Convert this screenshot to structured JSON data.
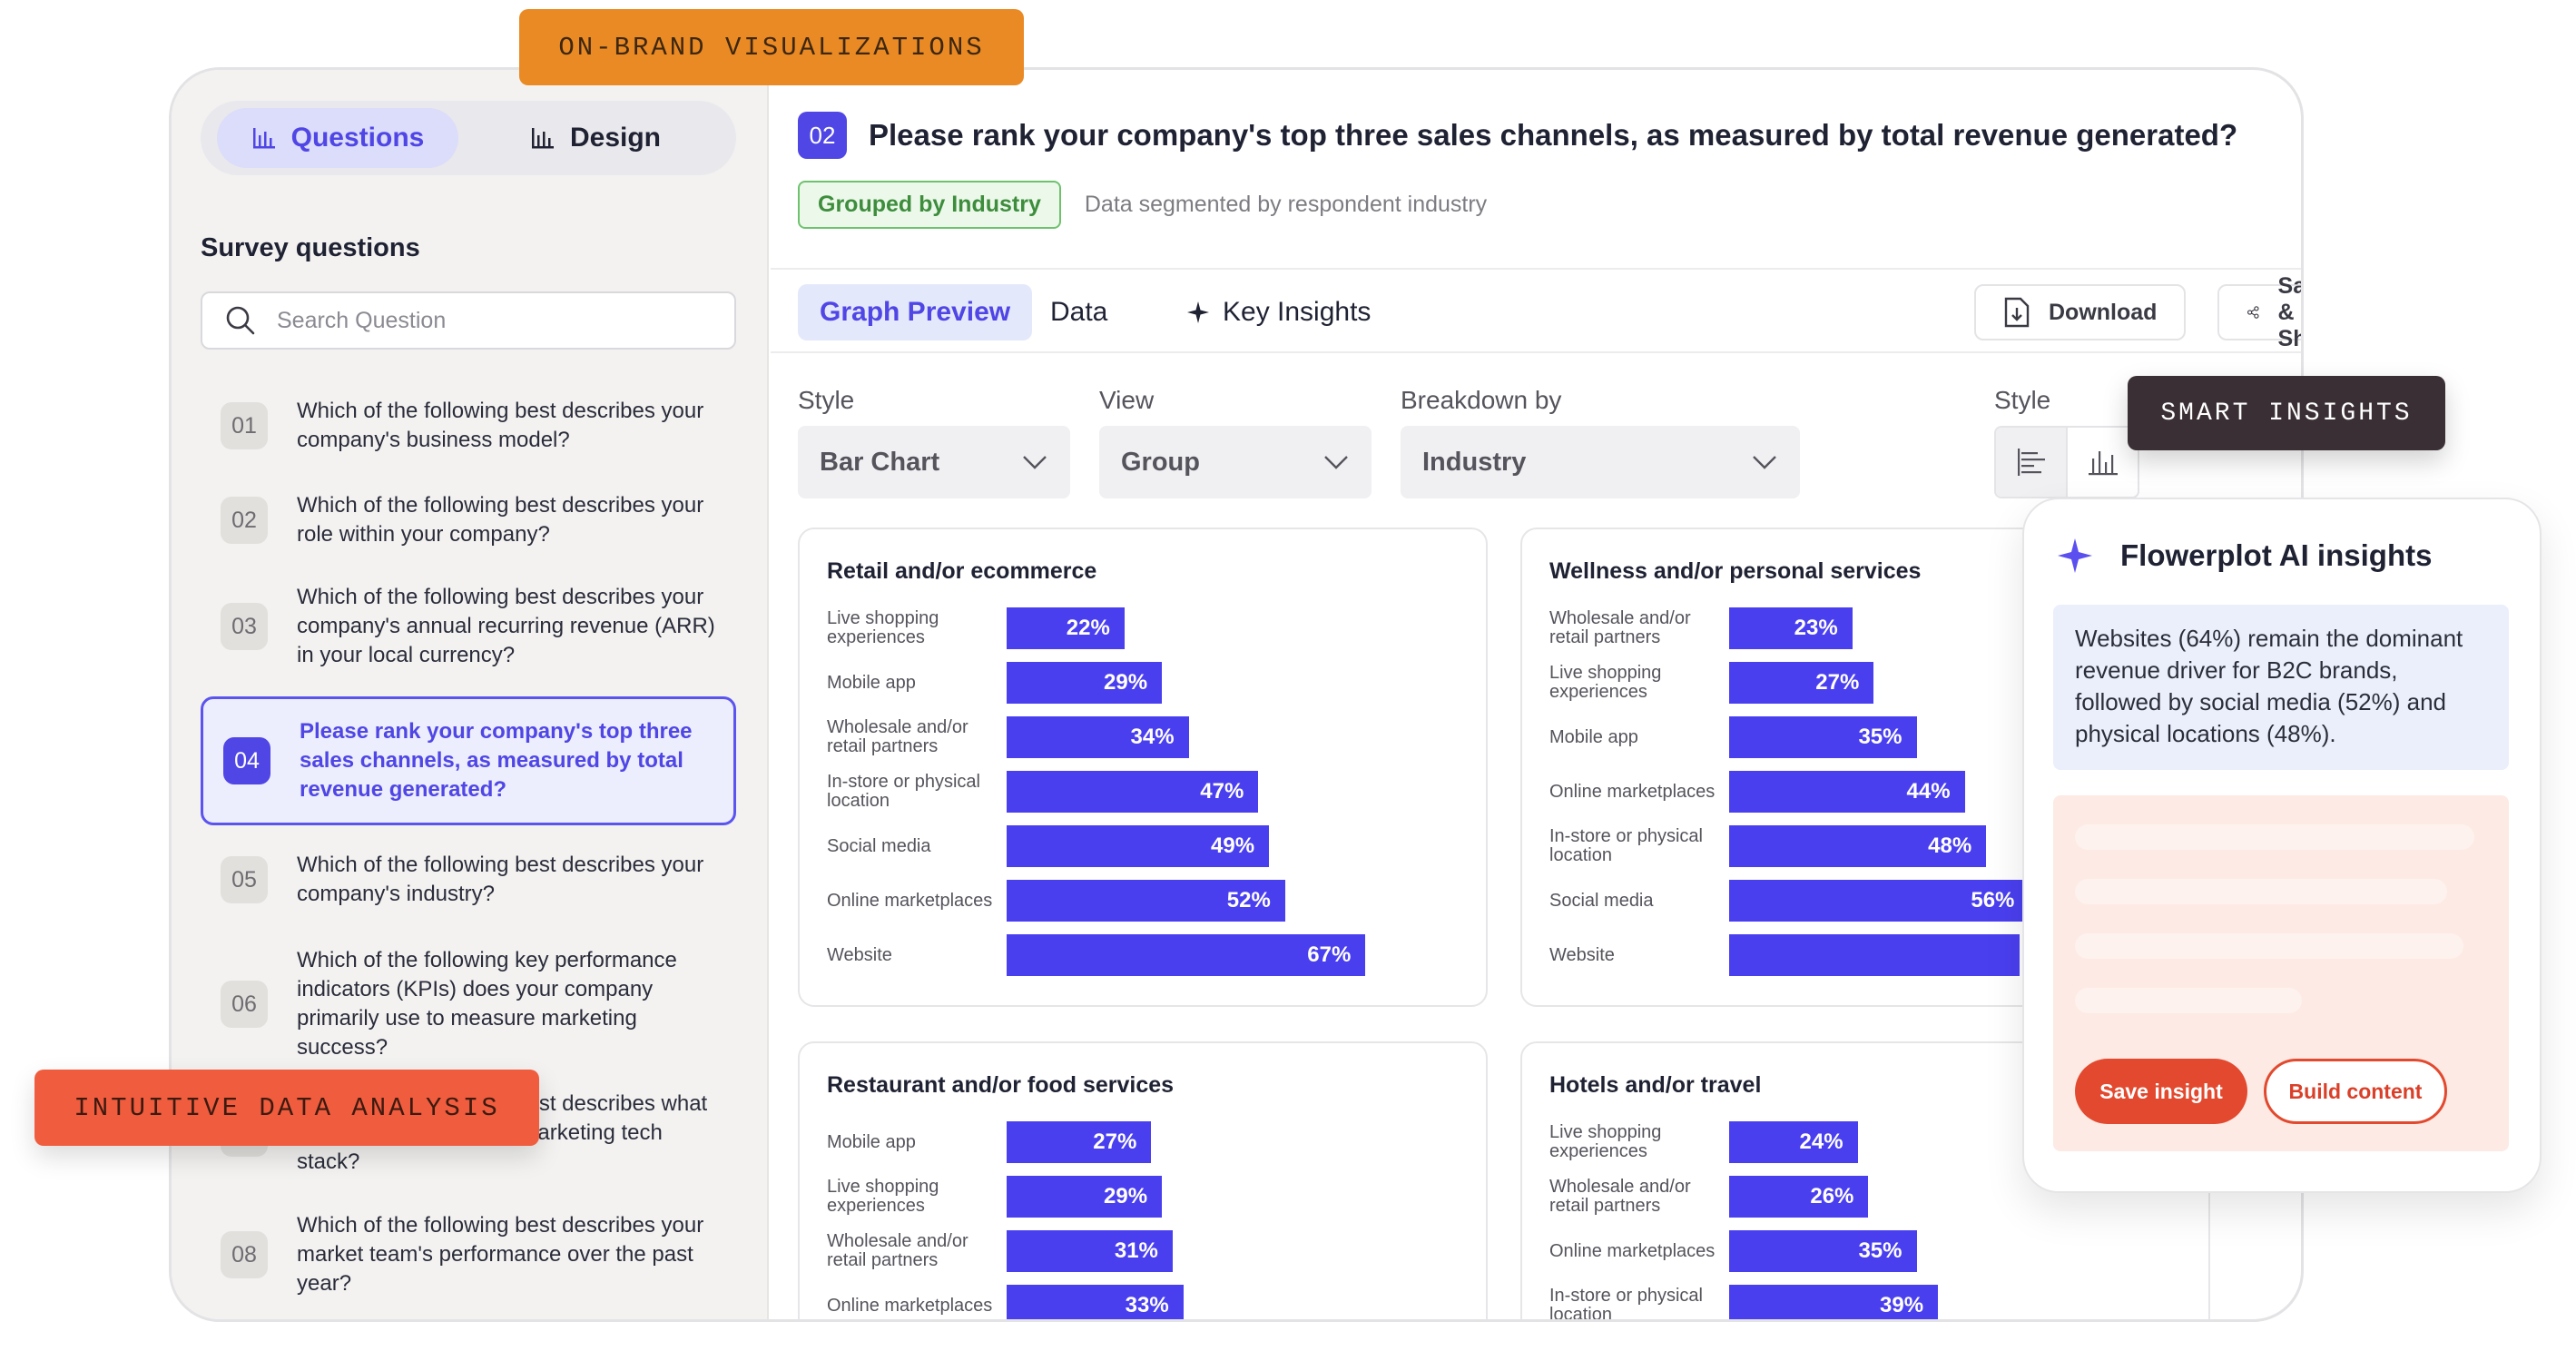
{
  "tags": {
    "on_brand": "ON-BRAND VISUALIZATIONS",
    "smart": "SMART INSIGHTS",
    "intuitive": "INTUITIVE DATA ANALYSIS"
  },
  "sidebar": {
    "seg_questions": "Questions",
    "seg_design": "Design",
    "title": "Survey questions",
    "search_placeholder": "Search Question",
    "questions": [
      {
        "num": "01",
        "text": "Which of the following best describes your company's business model?"
      },
      {
        "num": "02",
        "text": "Which of the following best describes your role within your company?"
      },
      {
        "num": "03",
        "text": "Which of the following best describes your company's annual recurring revenue (ARR) in your local currency?"
      },
      {
        "num": "04",
        "text": "Please rank your company's top three sales channels, as measured by total revenue generated?"
      },
      {
        "num": "05",
        "text": "Which of the following best describes your company's industry?"
      },
      {
        "num": "06",
        "text": "Which of the following key performance indicators (KPIs) does your company primarily use to measure marketing success?"
      },
      {
        "num": "07",
        "text": "Which of the following best describes what makes up your current marketing tech stack?"
      },
      {
        "num": "08",
        "text": "Which of the following best describes your market team's performance over the past year?"
      }
    ]
  },
  "question": {
    "num": "02",
    "title": "Please rank your company's top three sales channels, as measured by total revenue generated?",
    "group_pill": "Grouped by Industry",
    "group_note": "Data segmented by respondent industry"
  },
  "toolbar": {
    "tab_graph": "Graph Preview",
    "tab_data": "Data",
    "tab_insights": "Key Insights",
    "download": "Download",
    "save_share": "Save & Share"
  },
  "controls": {
    "style_label": "Style",
    "style_value": "Bar Chart",
    "view_label": "View",
    "view_value": "Group",
    "breakdown_label": "Breakdown by",
    "breakdown_value": "Industry",
    "style2_label": "Style"
  },
  "chart_data": [
    {
      "type": "bar",
      "title": "Retail and/or ecommerce",
      "unit": "%",
      "categories": [
        "Live shopping experiences",
        "Mobile app",
        "Wholesale and/or retail partners",
        "In-store or physical location",
        "Social media",
        "Online marketplaces",
        "Website"
      ],
      "values": [
        22,
        29,
        34,
        47,
        49,
        52,
        67
      ]
    },
    {
      "type": "bar",
      "title": "Wellness and/or personal services",
      "unit": "%",
      "categories": [
        "Wholesale and/or retail partners",
        "Live shopping experiences",
        "Mobile app",
        "Online marketplaces",
        "In-store or physical location",
        "Social media",
        "Website"
      ],
      "values": [
        23,
        27,
        35,
        44,
        48,
        56,
        null
      ]
    },
    {
      "type": "bar",
      "title": "Restaurant and/or food services",
      "unit": "%",
      "categories": [
        "Mobile app",
        "Live shopping experiences",
        "Wholesale and/or retail partners",
        "Online marketplaces"
      ],
      "values": [
        27,
        29,
        31,
        33
      ]
    },
    {
      "type": "bar",
      "title": "Hotels and/or travel",
      "unit": "%",
      "categories": [
        "Live shopping experiences",
        "Wholesale and/or retail partners",
        "Online marketplaces",
        "In-store or physical location"
      ],
      "values": [
        24,
        26,
        35,
        39
      ]
    }
  ],
  "ai": {
    "title": "Flowerplot AI insights",
    "text": "Websites (64%) remain the dominant revenue driver for B2C brands, followed by social media (52%) and physical locations (48%).",
    "save": "Save insight",
    "build": "Build content"
  },
  "colors": {
    "accent": "#4f46e5",
    "bar": "#4a3fef",
    "orange": "#ea8a25",
    "red": "#f05c3e",
    "dark": "#3a2f34",
    "save": "#e2492f"
  }
}
